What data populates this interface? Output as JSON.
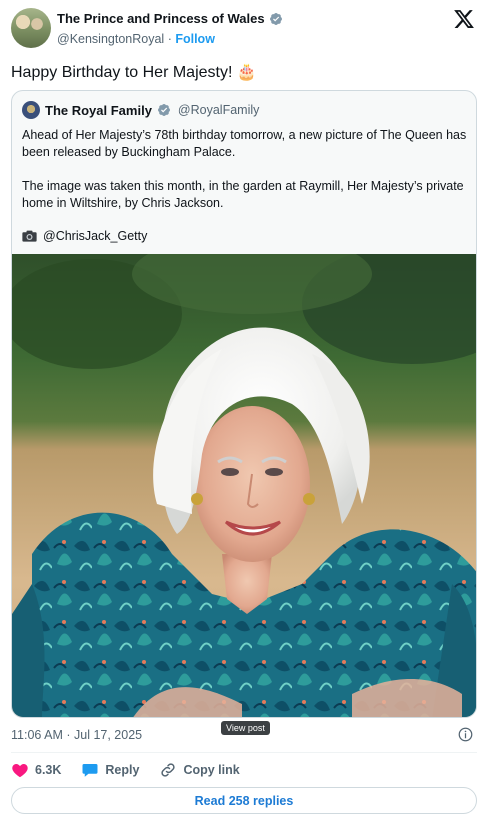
{
  "header": {
    "name": "The Prince and Princess of Wales",
    "handle": "@KensingtonRoyal",
    "separator": "·",
    "follow_label": "Follow"
  },
  "tweet": {
    "text": "Happy Birthday to Her Majesty! 🎂"
  },
  "quote": {
    "name": "The Royal Family",
    "handle": "@RoyalFamily",
    "paragraph1": "Ahead of Her Majesty’s 78th birthday tomorrow, a new picture of The Queen has been released by Buckingham Palace.",
    "paragraph2": "The image was taken this month, in the garden at Raymill, Her Majesty’s private home in Wiltshire, by Chris Jackson.",
    "credit": "@ChrisJack_Getty"
  },
  "meta": {
    "timestamp": "11:06 AM · Jul 17, 2025",
    "view_post": "View post"
  },
  "actions": {
    "likes": "6.3K",
    "reply_label": "Reply",
    "copy_link_label": "Copy link"
  },
  "replies_button": {
    "label": "Read 258 replies"
  },
  "colors": {
    "accent": "#1d9bf0",
    "like": "#f91880",
    "text": "#0f1419",
    "muted": "#536471"
  }
}
